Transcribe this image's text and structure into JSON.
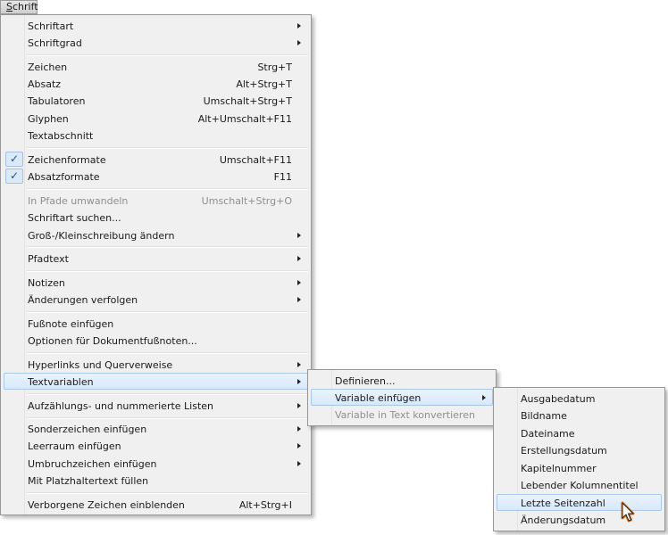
{
  "menubar": {
    "menu_accel": "S",
    "menu_rest": "chrift"
  },
  "main_menu": {
    "items": [
      {
        "label": "Schriftart",
        "shortcut": ""
      },
      {
        "label": "Schriftgrad",
        "shortcut": ""
      },
      {
        "label": "Zeichen",
        "shortcut": "Strg+T"
      },
      {
        "label": "Absatz",
        "shortcut": "Alt+Strg+T"
      },
      {
        "label": "Tabulatoren",
        "shortcut": "Umschalt+Strg+T"
      },
      {
        "label": "Glyphen",
        "shortcut": "Alt+Umschalt+F11"
      },
      {
        "label": "Textabschnitt",
        "shortcut": ""
      },
      {
        "label": "Zeichenformate",
        "shortcut": "Umschalt+F11",
        "checked": true
      },
      {
        "label": "Absatzformate",
        "shortcut": "F11",
        "checked": true
      },
      {
        "label": "In Pfade umwandeln",
        "shortcut": "Umschalt+Strg+O",
        "disabled": true
      },
      {
        "label": "Schriftart suchen...",
        "shortcut": ""
      },
      {
        "label": "Groß-/Kleinschreibung ändern",
        "shortcut": ""
      },
      {
        "label": "Pfadtext",
        "shortcut": ""
      },
      {
        "label": "Notizen",
        "shortcut": ""
      },
      {
        "label": "Änderungen verfolgen",
        "shortcut": ""
      },
      {
        "label": "Fußnote einfügen",
        "shortcut": ""
      },
      {
        "label": "Optionen für Dokumentfußnoten...",
        "shortcut": ""
      },
      {
        "label": "Hyperlinks und Querverweise",
        "shortcut": ""
      },
      {
        "label": "Textvariablen",
        "shortcut": "",
        "highlighted": true
      },
      {
        "label": "Aufzählungs- und nummerierte Listen",
        "shortcut": ""
      },
      {
        "label": "Sonderzeichen einfügen",
        "shortcut": ""
      },
      {
        "label": "Leerraum einfügen",
        "shortcut": ""
      },
      {
        "label": "Umbruchzeichen einfügen",
        "shortcut": ""
      },
      {
        "label": "Mit Platzhaltertext füllen",
        "shortcut": ""
      },
      {
        "label": "Verborgene Zeichen einblenden",
        "shortcut": "Alt+Strg+I"
      }
    ]
  },
  "textvariablen_menu": {
    "items": [
      {
        "label": "Definieren..."
      },
      {
        "label": "Variable einfügen",
        "highlighted": true
      },
      {
        "label": "Variable in Text konvertieren",
        "disabled": true
      }
    ]
  },
  "variable_menu": {
    "items": [
      {
        "label": "Ausgabedatum"
      },
      {
        "label": "Bildname"
      },
      {
        "label": "Dateiname"
      },
      {
        "label": "Erstellungsdatum"
      },
      {
        "label": "Kapitelnummer"
      },
      {
        "label": "Lebender Kolumnentitel"
      },
      {
        "label": "Letzte Seitenzahl",
        "highlighted": true
      },
      {
        "label": "Änderungsdatum"
      }
    ]
  },
  "colors": {
    "check": "#1d4f9b",
    "cursor_outline": "#e07010"
  },
  "icons": {
    "submenu": "chevron-right-icon",
    "check": "checkmark-icon",
    "cursor": "mouse-pointer-icon"
  }
}
